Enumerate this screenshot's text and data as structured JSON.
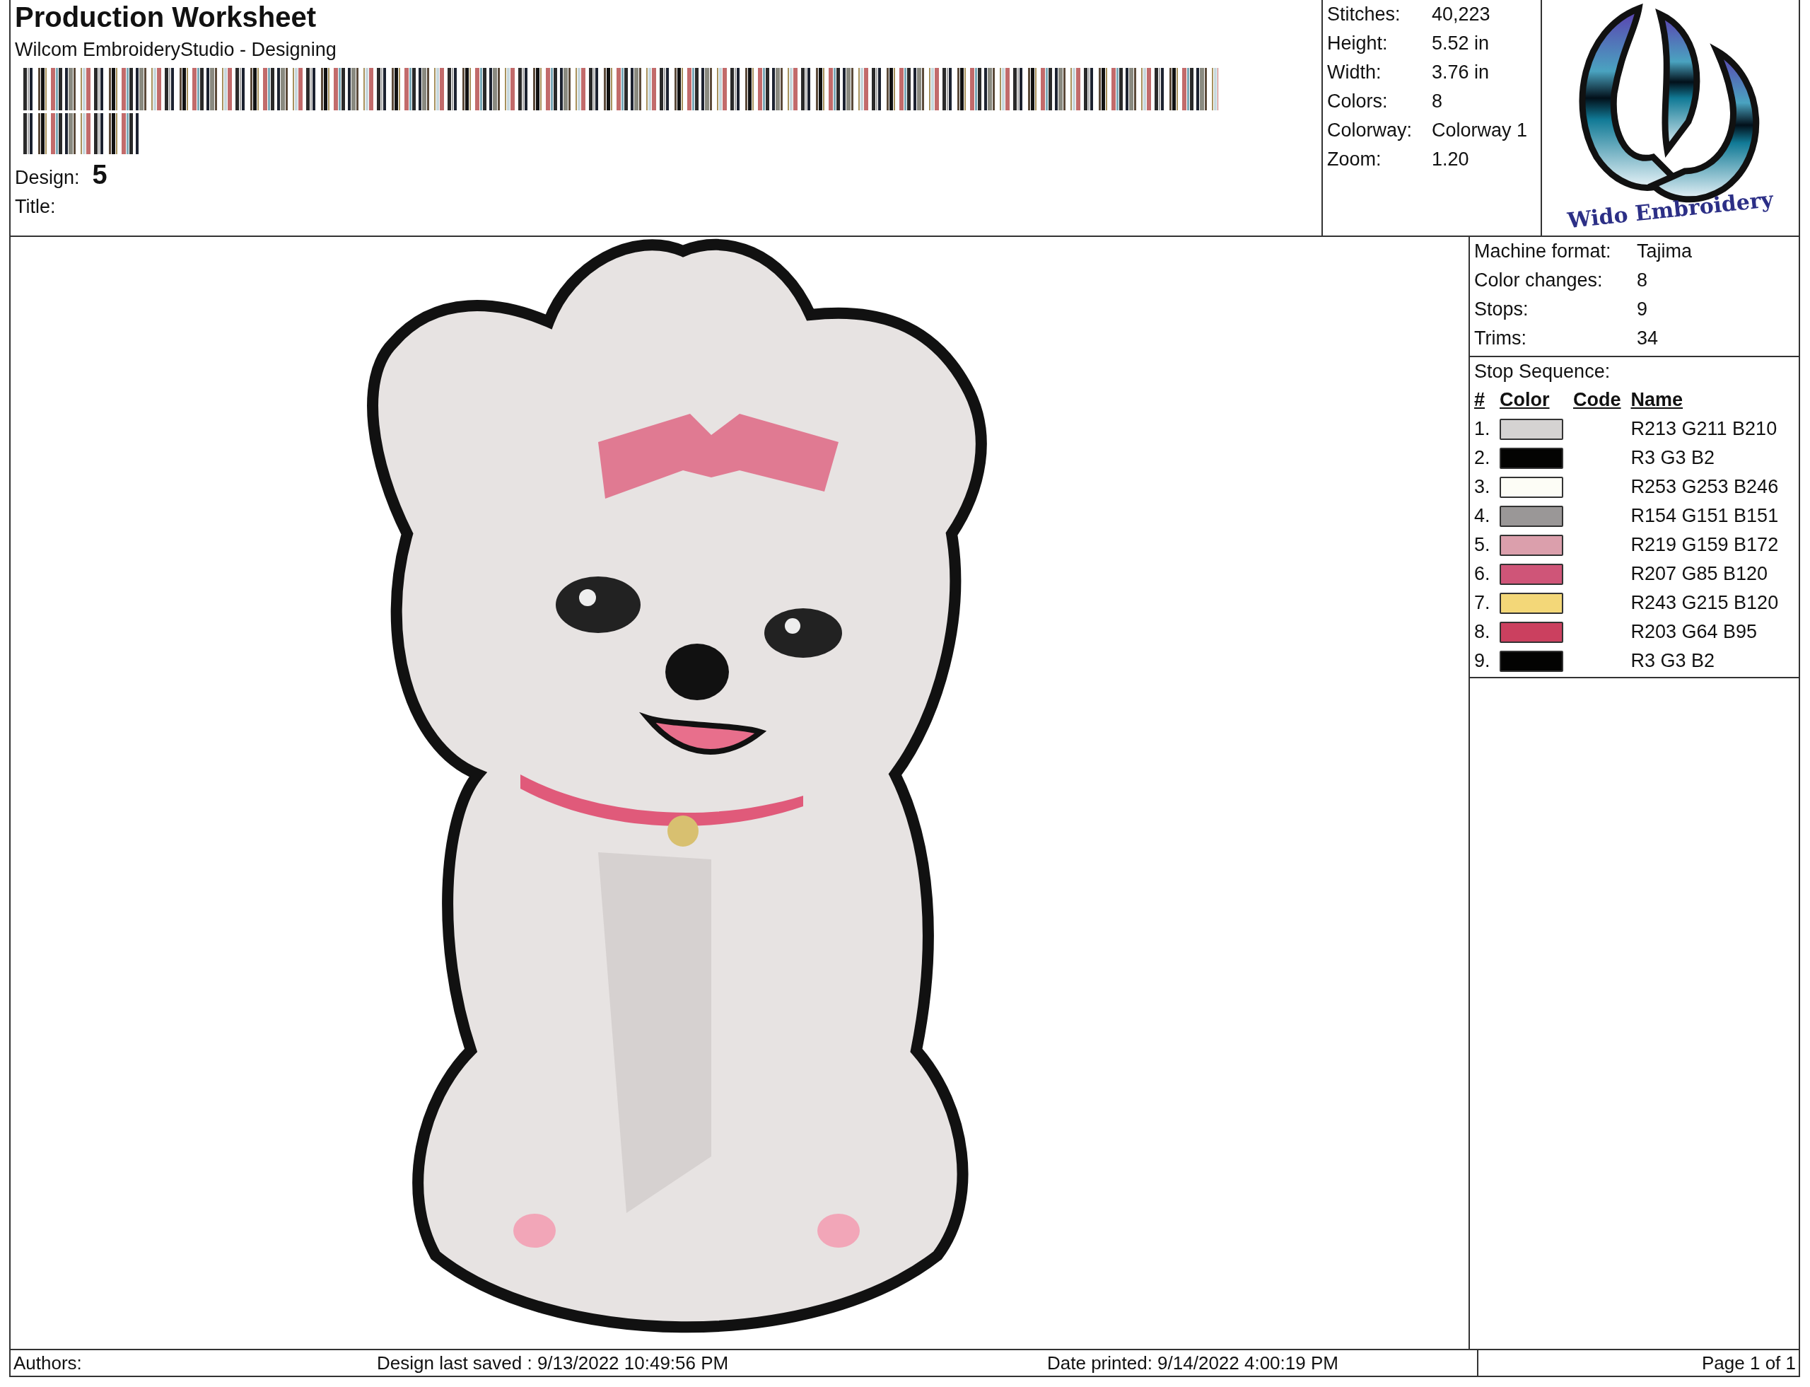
{
  "header": {
    "title": "Production Worksheet",
    "subtitle": "Wilcom EmbroideryStudio - Designing",
    "design_label": "Design:",
    "design_value": "5",
    "title_label": "Title:"
  },
  "stats": [
    {
      "label": "Stitches:",
      "value": "40,223"
    },
    {
      "label": "Height:",
      "value": "5.52 in"
    },
    {
      "label": "Width:",
      "value": "3.76 in"
    },
    {
      "label": "Colors:",
      "value": "8"
    },
    {
      "label": "Colorway:",
      "value": "Colorway 1"
    },
    {
      "label": "Zoom:",
      "value": "1.20"
    }
  ],
  "logo": {
    "text": "Wido Embroidery"
  },
  "machine": [
    {
      "label": "Machine format:",
      "value": "Tajima"
    },
    {
      "label": "Color changes:",
      "value": "8"
    },
    {
      "label": "Stops:",
      "value": "9"
    },
    {
      "label": "Trims:",
      "value": "34"
    }
  ],
  "stop_sequence": {
    "title": "Stop Sequence:",
    "columns": [
      "#",
      "Color",
      "Code",
      "Name"
    ],
    "rows": [
      {
        "number": "1.",
        "color": "#d5d3d2",
        "name": "R213 G211 B210"
      },
      {
        "number": "2.",
        "color": "#030302",
        "name": "R3 G3 B2"
      },
      {
        "number": "3.",
        "color": "#fdfdf6",
        "name": "R253 G253 B246"
      },
      {
        "number": "4.",
        "color": "#9a9797",
        "name": "R154 G151 B151"
      },
      {
        "number": "5.",
        "color": "#db9fac",
        "name": "R219 G159 B172"
      },
      {
        "number": "6.",
        "color": "#cf5578",
        "name": "R207 G85 B120"
      },
      {
        "number": "7.",
        "color": "#f3d778",
        "name": "R243 G215 B120"
      },
      {
        "number": "8.",
        "color": "#cb405f",
        "name": "R203 G64 B95"
      },
      {
        "number": "9.",
        "color": "#030302",
        "name": "R3 G3 B2"
      }
    ]
  },
  "footer": {
    "authors": "Authors:",
    "saved": "Design last saved : 9/13/2022 10:49:56 PM",
    "printed": "Date printed: 9/14/2022 4:00:19 PM",
    "page": "Page 1 of 1"
  }
}
